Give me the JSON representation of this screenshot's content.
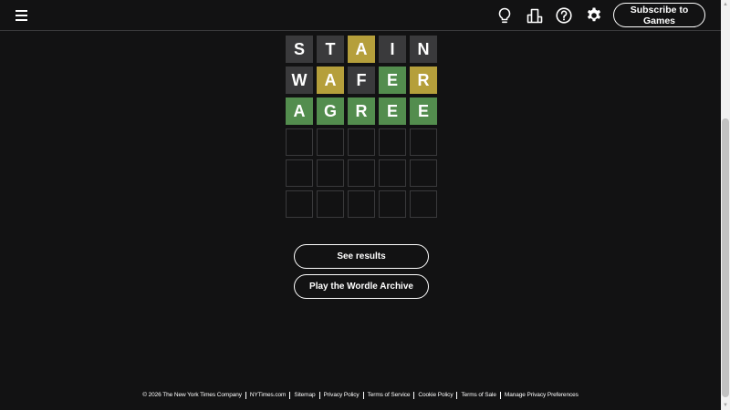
{
  "header": {
    "subscribe_label": "Subscribe to Games",
    "icons": [
      "menu-icon",
      "lightbulb-icon",
      "stats-icon",
      "help-icon",
      "gear-icon"
    ]
  },
  "board": {
    "rows": [
      [
        {
          "letter": "S",
          "state": "absent"
        },
        {
          "letter": "T",
          "state": "absent"
        },
        {
          "letter": "A",
          "state": "present"
        },
        {
          "letter": "I",
          "state": "absent"
        },
        {
          "letter": "N",
          "state": "absent"
        }
      ],
      [
        {
          "letter": "W",
          "state": "absent"
        },
        {
          "letter": "A",
          "state": "present"
        },
        {
          "letter": "F",
          "state": "absent"
        },
        {
          "letter": "E",
          "state": "correct"
        },
        {
          "letter": "R",
          "state": "present"
        }
      ],
      [
        {
          "letter": "A",
          "state": "correct"
        },
        {
          "letter": "G",
          "state": "correct"
        },
        {
          "letter": "R",
          "state": "correct"
        },
        {
          "letter": "E",
          "state": "correct"
        },
        {
          "letter": "E",
          "state": "correct"
        }
      ],
      [
        {
          "letter": "",
          "state": "empty"
        },
        {
          "letter": "",
          "state": "empty"
        },
        {
          "letter": "",
          "state": "empty"
        },
        {
          "letter": "",
          "state": "empty"
        },
        {
          "letter": "",
          "state": "empty"
        }
      ],
      [
        {
          "letter": "",
          "state": "empty"
        },
        {
          "letter": "",
          "state": "empty"
        },
        {
          "letter": "",
          "state": "empty"
        },
        {
          "letter": "",
          "state": "empty"
        },
        {
          "letter": "",
          "state": "empty"
        }
      ],
      [
        {
          "letter": "",
          "state": "empty"
        },
        {
          "letter": "",
          "state": "empty"
        },
        {
          "letter": "",
          "state": "empty"
        },
        {
          "letter": "",
          "state": "empty"
        },
        {
          "letter": "",
          "state": "empty"
        }
      ]
    ]
  },
  "actions": {
    "see_results": "See results",
    "archive": "Play the Wordle Archive"
  },
  "footer": {
    "copyright": "© 2026 The New York Times Company",
    "links": [
      "NYTimes.com",
      "Sitemap",
      "Privacy Policy",
      "Terms of Service",
      "Cookie Policy",
      "Terms of Sale",
      "Manage Privacy Preferences"
    ]
  },
  "colors": {
    "background": "#121213",
    "correct": "#538d4e",
    "present": "#b59f3b",
    "absent": "#3a3a3c"
  }
}
